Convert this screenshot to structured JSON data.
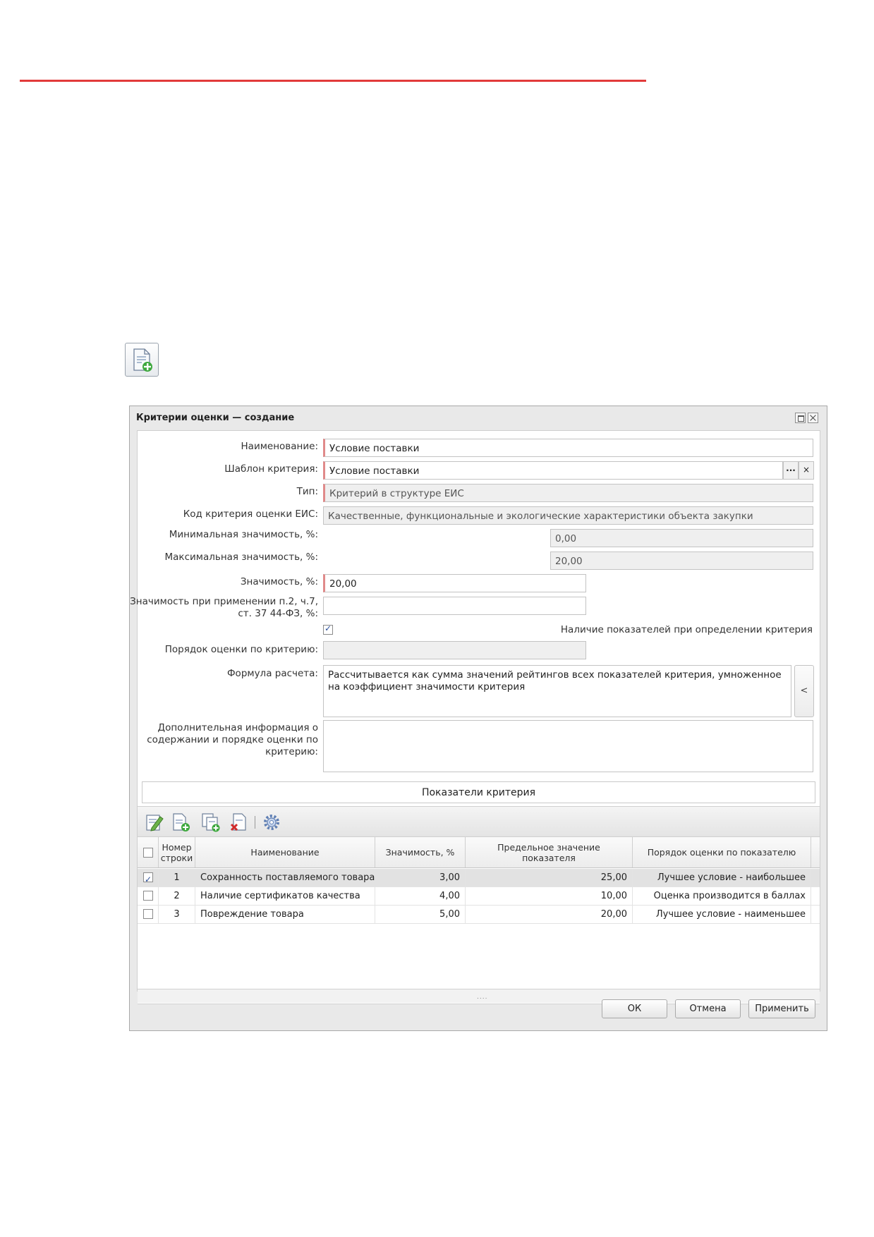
{
  "dialog": {
    "title": "Критерии оценки — создание",
    "fields": {
      "name_label": "Наименование:",
      "name_value": "Условие поставки",
      "template_label": "Шаблон критерия:",
      "template_value": "Условие поставки",
      "template_pick": "...",
      "template_clear": "×",
      "type_label": "Тип:",
      "type_value": "Критерий в структуре ЕИС",
      "eis_code_label": "Код критерия оценки ЕИС:",
      "eis_code_value": "Качественные, функциональные и экологические характеристики объекта закупки",
      "min_label": "Минимальная значимость, %:",
      "min_value": "0,00",
      "max_label": "Максимальная значимость, %:",
      "max_value": "20,00",
      "weight_label": "Значимость, %:",
      "weight_value": "20,00",
      "weight_p2_label": "Значимость при применении п.2, ч.7, ст. 37 44-ФЗ, %:",
      "weight_p2_value": "",
      "indicators_checkbox_label": "Наличие показателей при определении критерия",
      "indicators_checked": true,
      "order_label": "Порядок оценки по критерию:",
      "order_value": "",
      "formula_label": "Формула расчета:",
      "formula_value": "Рассчитывается как сумма значений рейтингов всех показателей критерия, умноженное на коэффициент значимости критерия",
      "formula_side_button": "<",
      "extra_label": "Дополнительная информация о содержании и порядке оценки по критерию:",
      "extra_value": ""
    },
    "section_title": "Показатели критерия",
    "toolbar_icons": [
      "edit-icon",
      "add-icon",
      "copy-icon",
      "delete-icon",
      "settings-icon"
    ],
    "table": {
      "headers": [
        "Номер строки",
        "Наименование",
        "Значимость, %",
        "Предельное значение показателя",
        "Порядок оценки по показателю"
      ],
      "rows": [
        {
          "checked": true,
          "num": "1",
          "name": "Сохранность поставляемого товара",
          "weight": "3,00",
          "limit": "25,00",
          "order": "Лучшее условие - наибольшее"
        },
        {
          "checked": false,
          "num": "2",
          "name": "Наличие сертификатов качества",
          "weight": "4,00",
          "limit": "10,00",
          "order": "Оценка производится в баллах"
        },
        {
          "checked": false,
          "num": "3",
          "name": "Повреждение товара",
          "weight": "5,00",
          "limit": "20,00",
          "order": "Лучшее условие - наименьшее"
        }
      ],
      "splitter": "...."
    },
    "buttons": {
      "ok": "ОК",
      "cancel": "Отмена",
      "apply": "Применить"
    }
  },
  "colors": {
    "accent_line": "#e23a3a",
    "required_marker": "#e08a8a"
  }
}
